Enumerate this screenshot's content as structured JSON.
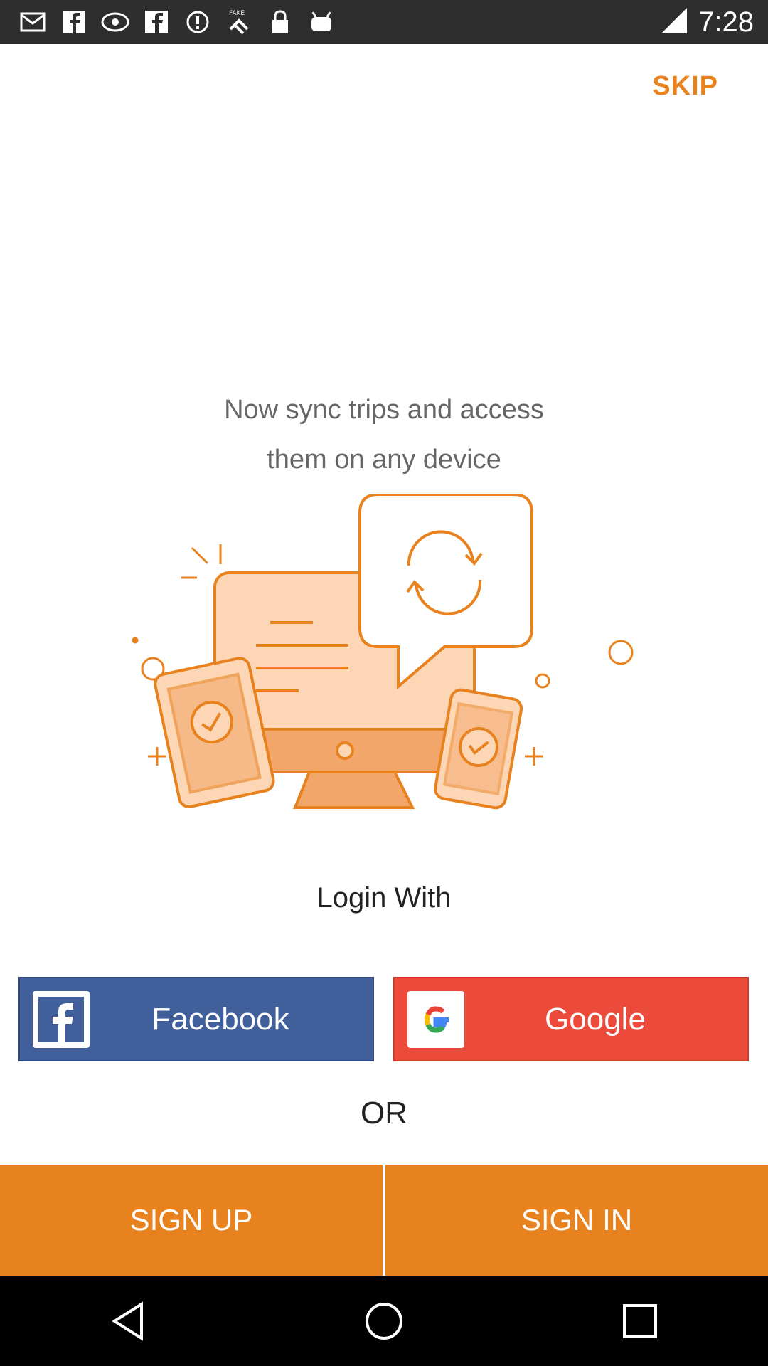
{
  "status_bar": {
    "time": "7:28",
    "left_icons": [
      "mail-icon",
      "facebook-notif-icon",
      "vr-icon",
      "facebook-notif-icon",
      "alert-icon",
      "fake-gps-icon",
      "lock-icon",
      "android-icon"
    ],
    "right_icons": [
      "signal-icon"
    ]
  },
  "top": {
    "skip_label": "SKIP"
  },
  "onboarding": {
    "headline_line1": "Now sync trips and access",
    "headline_line2": "them on any device"
  },
  "login": {
    "heading": "Login With",
    "facebook_label": "Facebook",
    "google_label": "Google",
    "or_label": "OR"
  },
  "bottom_actions": {
    "signup_label": "SIGN UP",
    "signin_label": "SIGN IN"
  },
  "colors": {
    "accent": "#e8821f",
    "facebook": "#41609b",
    "google": "#ec4a3b"
  },
  "nav": {
    "back": "back-icon",
    "home": "home-icon",
    "recents": "recents-icon"
  }
}
